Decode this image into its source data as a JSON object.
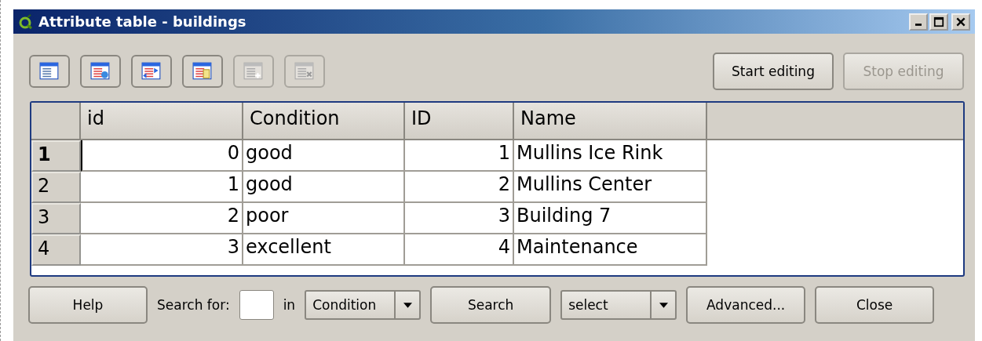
{
  "window": {
    "title": "Attribute table - buildings"
  },
  "toolbar": [
    {
      "kind": "table",
      "disabled": false
    },
    {
      "kind": "table-arrow",
      "disabled": false
    },
    {
      "kind": "table-swap",
      "disabled": false
    },
    {
      "kind": "table-copy",
      "disabled": false
    },
    {
      "kind": "table-add",
      "disabled": true
    },
    {
      "kind": "table-remove",
      "disabled": true
    }
  ],
  "edit_buttons": [
    {
      "label": "Start editing",
      "disabled": false
    },
    {
      "label": "Stop editing",
      "disabled": true
    }
  ],
  "table": {
    "columns": [
      "id",
      "Condition",
      "ID",
      "Name"
    ],
    "rows": [
      {
        "header": "1",
        "selected": true,
        "cells": [
          "0",
          "good",
          "1",
          "Mullins Ice Rink"
        ]
      },
      {
        "header": "2",
        "selected": false,
        "cells": [
          "1",
          "good",
          "2",
          "Mullins Center"
        ]
      },
      {
        "header": "3",
        "selected": false,
        "cells": [
          "2",
          "poor",
          "3",
          "Building 7"
        ]
      },
      {
        "header": "4",
        "selected": false,
        "cells": [
          "3",
          "excellent",
          "4",
          "Maintenance"
        ]
      }
    ]
  },
  "bottom": {
    "help": "Help",
    "search_label": "Search for:",
    "in_label": "in",
    "field": "Condition",
    "search": "Search",
    "mode": "select",
    "advanced": "Advanced...",
    "close": "Close"
  }
}
